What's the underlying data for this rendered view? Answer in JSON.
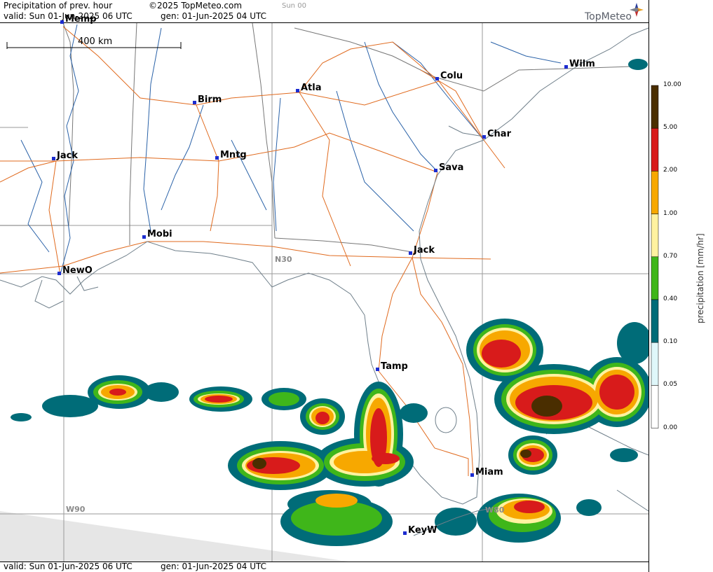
{
  "header": {
    "title": "Precipitation of prev. hour",
    "copyright": "©2025 TopMeteo.com",
    "run": "Sun 00",
    "valid": "valid:  Sun  01-Jun-2025  06 UTC",
    "gen": "gen: 01-Jun-2025 04 UTC"
  },
  "footer": {
    "valid": "valid:  Sun  01-Jun-2025  06 UTC",
    "gen": "gen: 01-Jun-2025 04 UTC"
  },
  "logo": {
    "text": "TopMeteo"
  },
  "scale_bar": {
    "label": "400 km"
  },
  "grid_labels": {
    "lat": "N30",
    "lon_west": "W90",
    "lon_east": "W80"
  },
  "cities": {
    "memp": "Memp",
    "wilm": "Wilm",
    "colu": "Colu",
    "atla": "Atla",
    "birm": "Birm",
    "char": "Char",
    "jack_ms": "Jack",
    "mntg": "Mntg",
    "sava": "Sava",
    "mobi": "Mobi",
    "jack_fl": "Jack",
    "newo": "NewO",
    "tamp": "Tamp",
    "miam": "Miam",
    "keyw": "KeyW"
  },
  "legend": {
    "title": "precipitation  [mm/hr]",
    "ticks": [
      "10.00",
      "5.00",
      "2.00",
      "1.00",
      "0.70",
      "0.40",
      "0.10",
      "0.05",
      "0.00"
    ],
    "colors": [
      "#4a2e00",
      "#d81b1b",
      "#f7a800",
      "#fff2a0",
      "#3fb61a",
      "#006c78",
      "#dff7fa",
      "#ffffff"
    ],
    "colors_meaning": "brown >5, red 2-5, orange 1-2, light yellow 0.7-1, green 0.4-0.7, teal 0.1-0.4, pale cyan 0.05-0.1"
  },
  "colors": {
    "coast": "#6f7f8a",
    "rivers": "#2a62a8",
    "roads": "#e06a1e",
    "borders": "#6a6a6a",
    "grid": "#9a9a9a",
    "city_marker": "#1c2ccf"
  }
}
